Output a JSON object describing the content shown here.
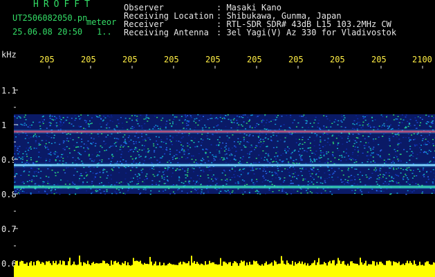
{
  "header": {
    "title": "HROFFT",
    "filename": "UT2506082050.pn",
    "mode": "meteor",
    "datetime": "25.06.08 20:50",
    "count": "1.."
  },
  "info": [
    {
      "label": "Observer",
      "value": ": Masaki Kano"
    },
    {
      "label": "Receiving Location",
      "value": ": Shibukawa, Gunma, Japan"
    },
    {
      "label": "Receiver",
      "value": ": RTL-SDR SDR# 43dB L15 103.2MHz CW"
    },
    {
      "label": "Receiving Antenna",
      "value": ": 3el Yagi(V) Az 330 for Vladivostok"
    }
  ],
  "axis": {
    "unit": "kHz",
    "y_labels": [
      "1.1",
      "1",
      "0.9",
      "0.8",
      "0.7",
      "0.6"
    ],
    "x_labels": [
      "205",
      "205",
      "205",
      "205",
      "205",
      "205",
      "205",
      "205",
      "205",
      "2100"
    ]
  },
  "colors": {
    "background": "#000000",
    "text_green": "#33dd66",
    "text_white": "#e8e8e8",
    "text_yellow": "#ffee44",
    "spectrum_bar": "#ffff00"
  },
  "chart_data": {
    "type": "heatmap",
    "x_tick_labels": [
      "205",
      "205",
      "205",
      "205",
      "205",
      "205",
      "205",
      "205",
      "205",
      "2100"
    ],
    "y_tick_labels": [
      "1.1",
      "1",
      "0.9",
      "0.8",
      "0.7",
      "0.6"
    ],
    "ylim": [
      0.58,
      1.15
    ],
    "ylabel": "kHz",
    "noise_band_khz": [
      0.8,
      1.03
    ],
    "carrier_lines_khz": [
      0.98,
      0.883,
      0.82
    ],
    "bottom_strip": "yellow amplitude profile"
  }
}
